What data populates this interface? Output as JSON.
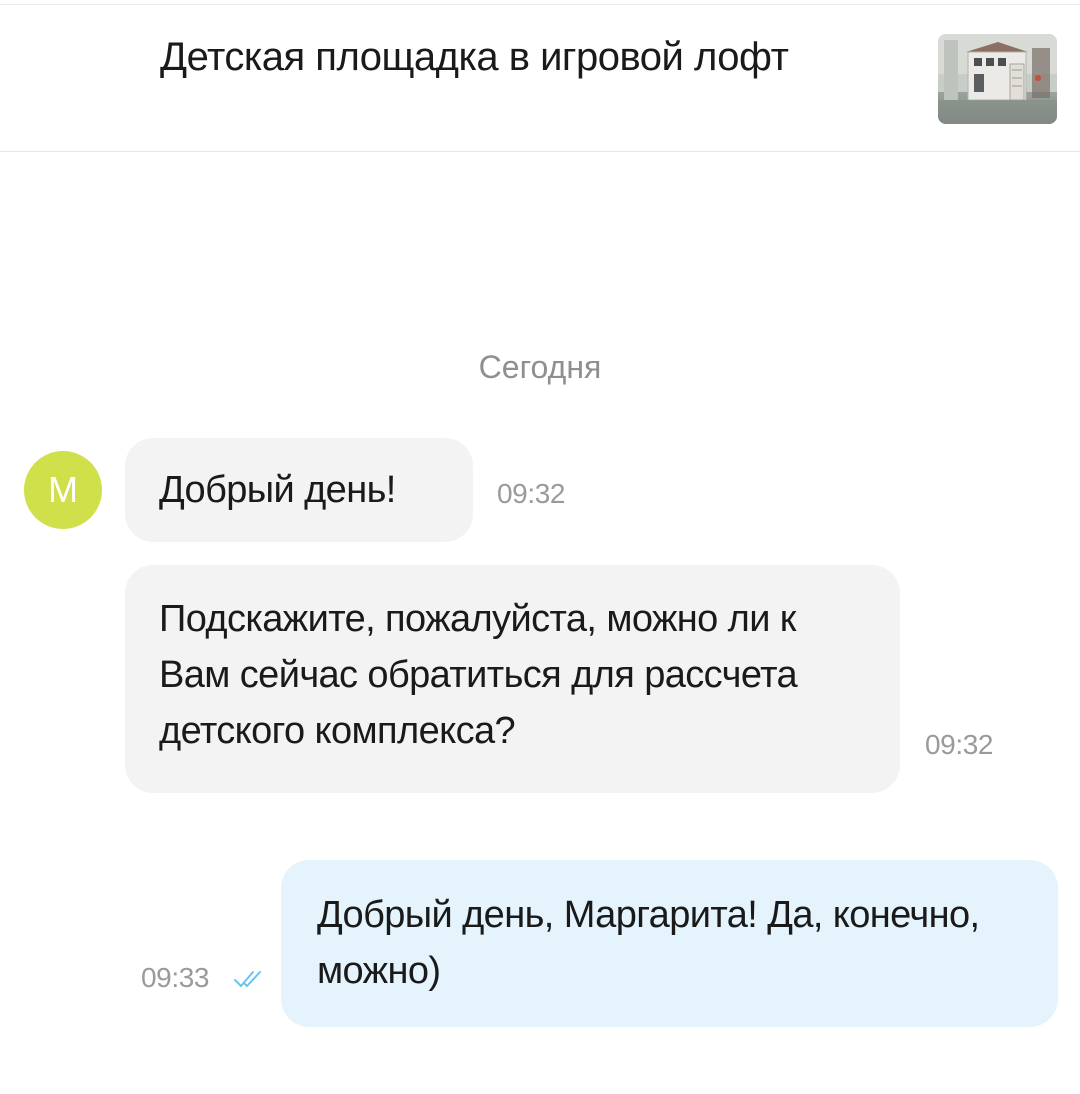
{
  "header": {
    "title": "Детская площадка в игровой лофт",
    "thumbnail_icon": "playground-thumbnail-image"
  },
  "chat": {
    "date_separator": "Сегодня",
    "incoming_avatar_letter": "M",
    "messages": [
      {
        "direction": "incoming",
        "text": "Добрый день!",
        "time": "09:32"
      },
      {
        "direction": "incoming",
        "text": "Подскажите, пожалуйста, можно ли к Вам сейчас обратиться для рассчета детского комплекса?",
        "time": "09:32"
      },
      {
        "direction": "outgoing",
        "text": "Добрый день, Маргарита! Да, конечно, можно)",
        "time": "09:33",
        "status_icon": "double-check-icon"
      }
    ]
  },
  "colors": {
    "avatar": "#cfe04a",
    "incoming_bubble": "#f3f3f3",
    "outgoing_bubble": "#e4f3fc",
    "read_check": "#6cc3ee",
    "muted_text": "#9a9a9a"
  }
}
